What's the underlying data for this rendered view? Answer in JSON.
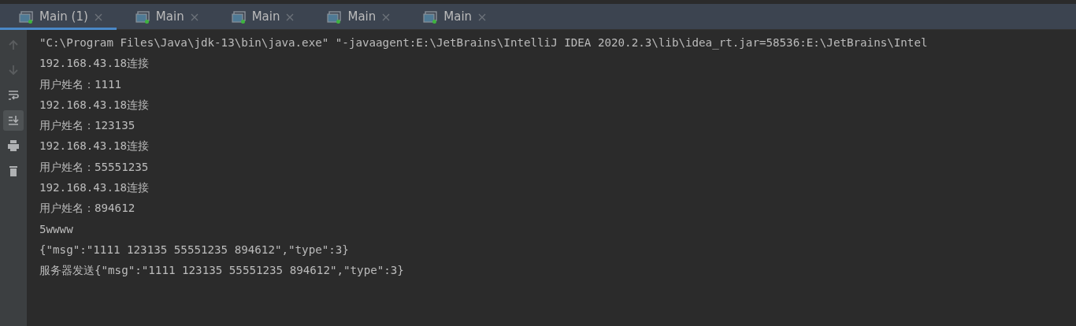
{
  "tabs": [
    {
      "label": "Main (1)",
      "selected": true
    },
    {
      "label": "Main",
      "selected": false
    },
    {
      "label": "Main",
      "selected": false
    },
    {
      "label": "Main",
      "selected": false
    },
    {
      "label": "Main",
      "selected": false
    }
  ],
  "toolbar": [
    {
      "kind": "up",
      "disabled": true,
      "selected": false
    },
    {
      "kind": "down",
      "disabled": true,
      "selected": false
    },
    {
      "kind": "wrap",
      "disabled": false,
      "selected": false
    },
    {
      "kind": "scroll-end",
      "disabled": false,
      "selected": true
    },
    {
      "kind": "print",
      "disabled": false,
      "selected": false
    },
    {
      "kind": "trash",
      "disabled": false,
      "selected": false
    }
  ],
  "console_lines": [
    "\"C:\\Program Files\\Java\\jdk-13\\bin\\java.exe\" \"-javaagent:E:\\JetBrains\\IntelliJ IDEA 2020.2.3\\lib\\idea_rt.jar=58536:E:\\JetBrains\\Intel",
    "192.168.43.18连接",
    "用户姓名：1111",
    "192.168.43.18连接",
    "用户姓名：123135",
    "192.168.43.18连接",
    "用户姓名：55551235",
    "192.168.43.18连接",
    "用户姓名：894612",
    "5wwww",
    "{\"msg\":\"1111 123135 55551235 894612\",\"type\":3}",
    "服务器发送{\"msg\":\"1111 123135 55551235 894612\",\"type\":3}"
  ]
}
